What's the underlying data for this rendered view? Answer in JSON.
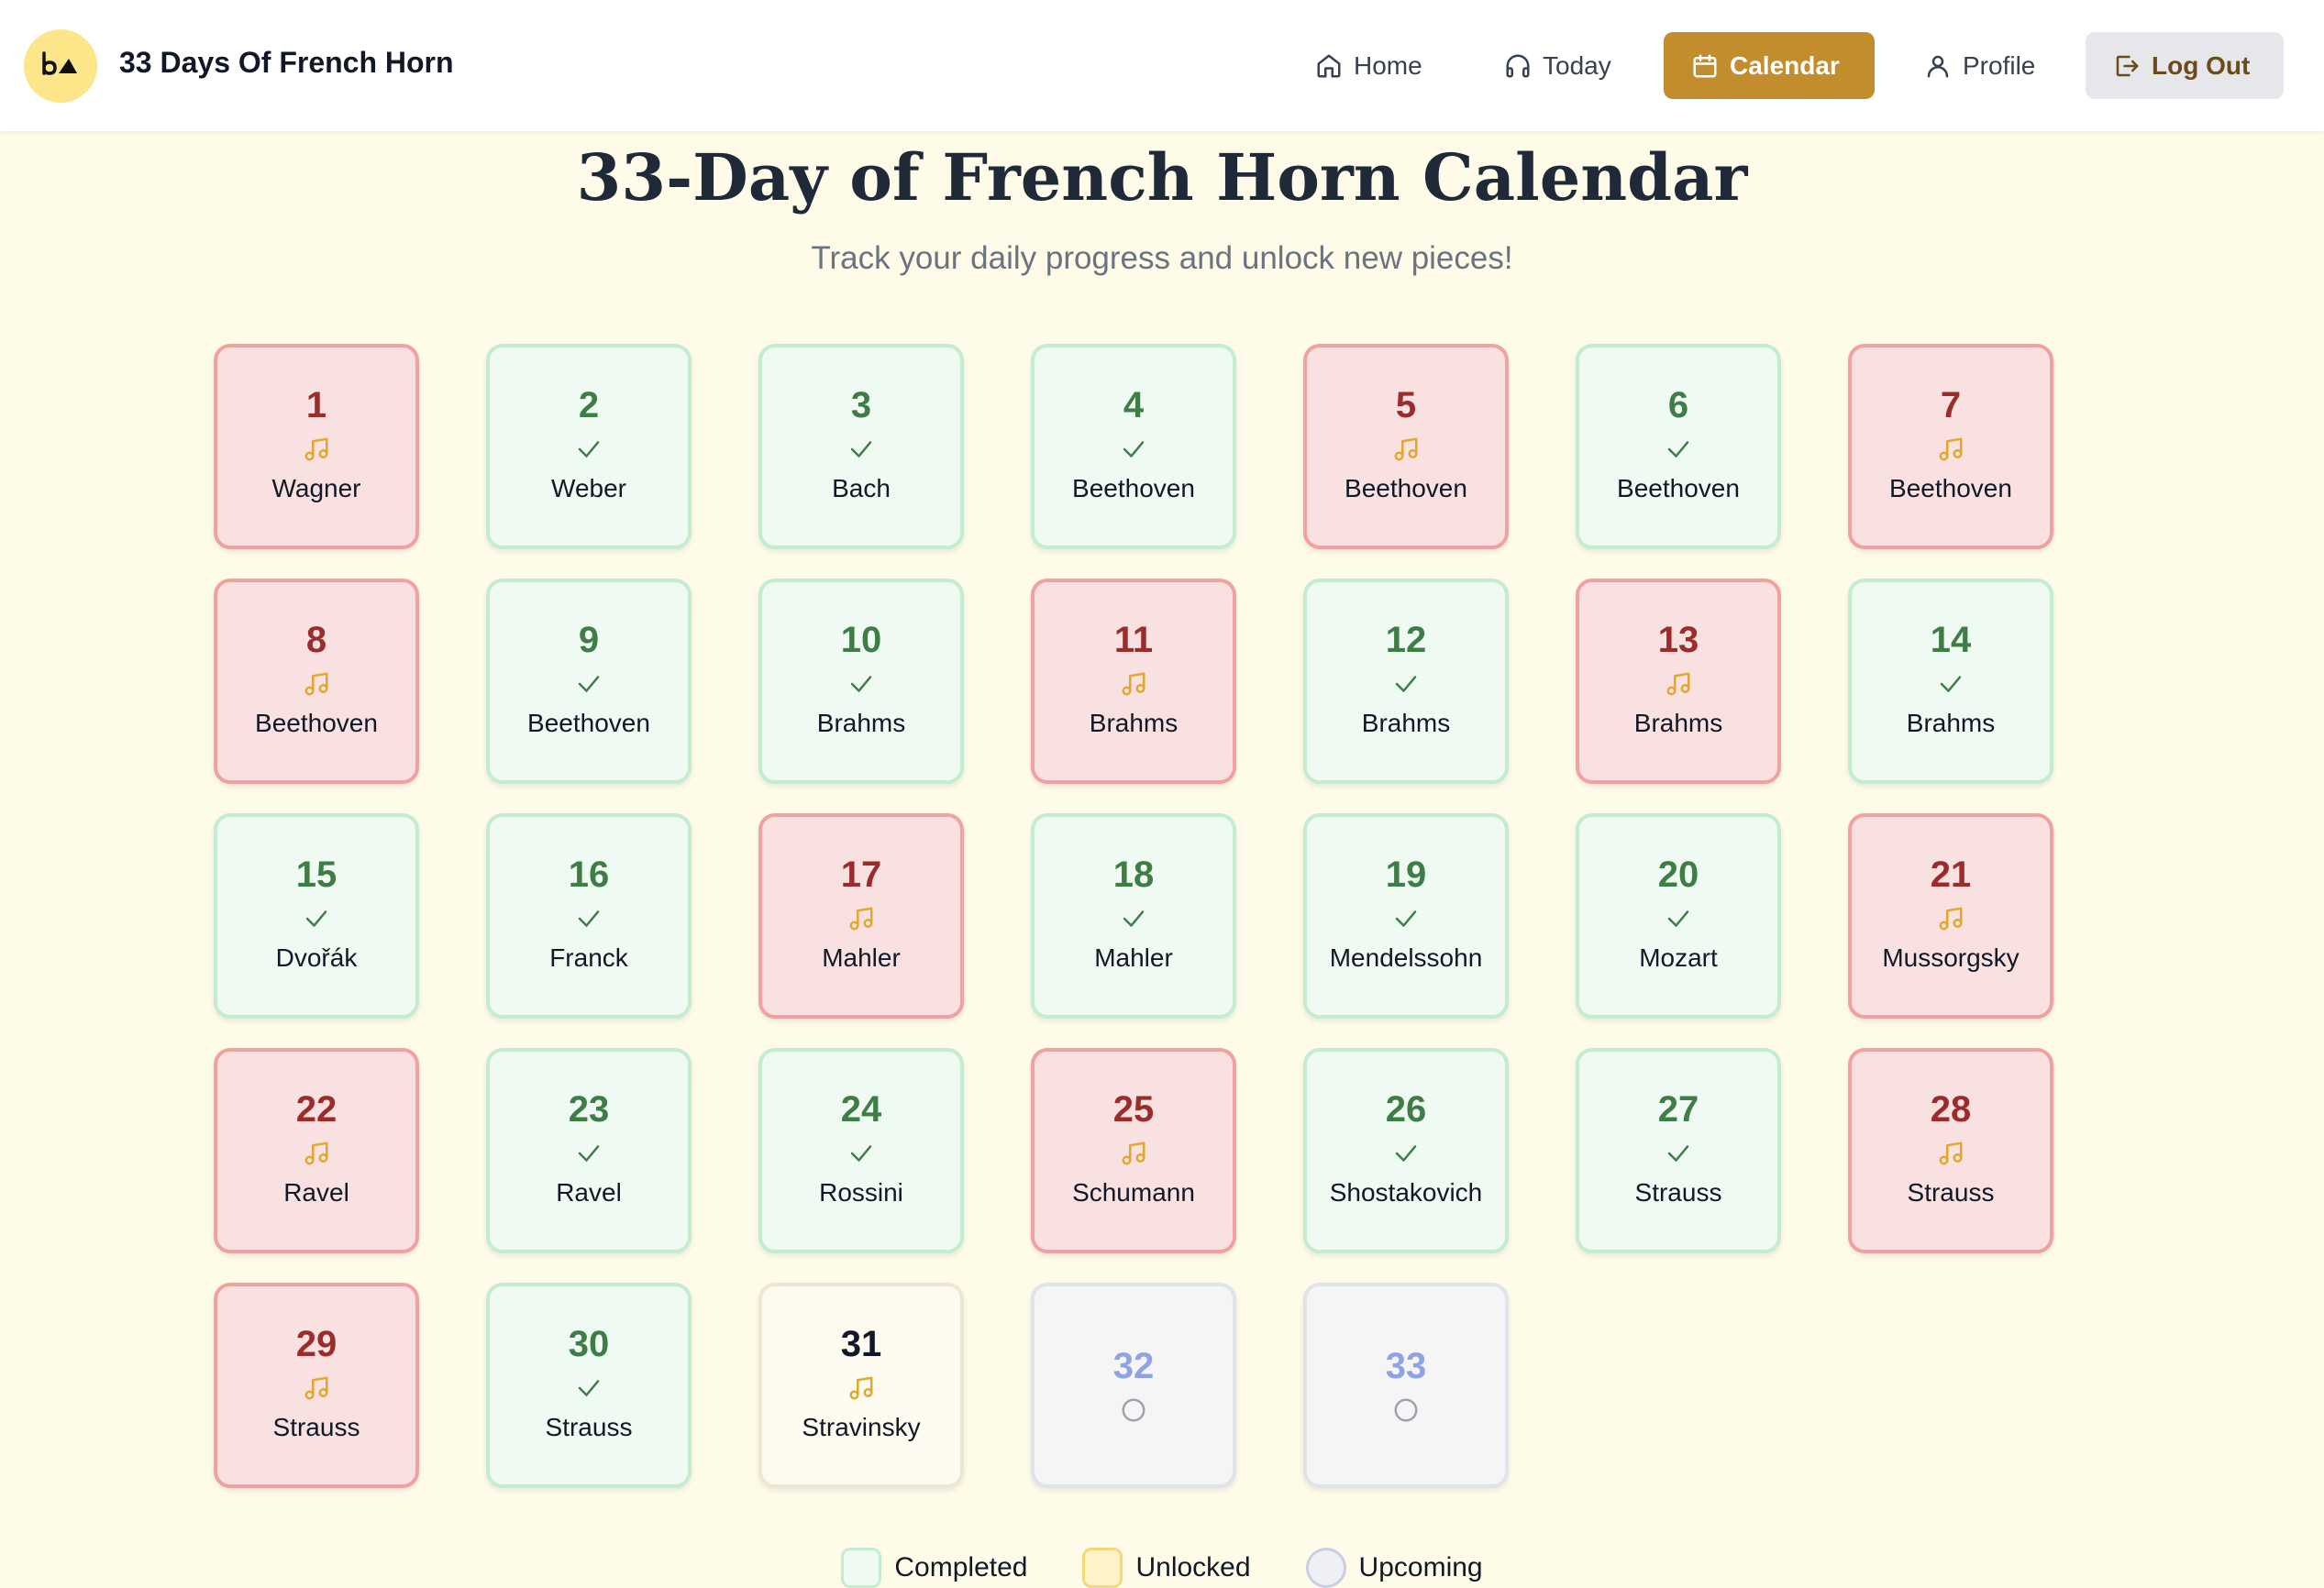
{
  "header": {
    "brand": "33 Days Of French Horn",
    "nav": {
      "home": "Home",
      "today": "Today",
      "calendar": "Calendar",
      "profile": "Profile",
      "logout": "Log Out"
    }
  },
  "page": {
    "title": "33-Day of French Horn Calendar",
    "subtitle": "Track your daily progress and unlock new pieces!"
  },
  "colors": {
    "accent": "#c38c2c",
    "completed": "#3f7d46",
    "unlocked": "#9b2c2c",
    "upcoming": "#8ea2e4"
  },
  "days": [
    {
      "day": "1",
      "composer": "Wagner",
      "status": "unlocked",
      "icon": "music-note-icon"
    },
    {
      "day": "2",
      "composer": "Weber",
      "status": "completed",
      "icon": "check-icon"
    },
    {
      "day": "3",
      "composer": "Bach",
      "status": "completed",
      "icon": "check-icon"
    },
    {
      "day": "4",
      "composer": "Beethoven",
      "status": "completed",
      "icon": "check-icon"
    },
    {
      "day": "5",
      "composer": "Beethoven",
      "status": "unlocked",
      "icon": "music-note-icon"
    },
    {
      "day": "6",
      "composer": "Beethoven",
      "status": "completed",
      "icon": "check-icon"
    },
    {
      "day": "7",
      "composer": "Beethoven",
      "status": "unlocked",
      "icon": "music-note-icon"
    },
    {
      "day": "8",
      "composer": "Beethoven",
      "status": "unlocked",
      "icon": "music-note-icon"
    },
    {
      "day": "9",
      "composer": "Beethoven",
      "status": "completed",
      "icon": "check-icon"
    },
    {
      "day": "10",
      "composer": "Brahms",
      "status": "completed",
      "icon": "check-icon"
    },
    {
      "day": "11",
      "composer": "Brahms",
      "status": "unlocked",
      "icon": "music-note-icon"
    },
    {
      "day": "12",
      "composer": "Brahms",
      "status": "completed",
      "icon": "check-icon"
    },
    {
      "day": "13",
      "composer": "Brahms",
      "status": "unlocked",
      "icon": "music-note-icon"
    },
    {
      "day": "14",
      "composer": "Brahms",
      "status": "completed",
      "icon": "check-icon"
    },
    {
      "day": "15",
      "composer": "Dvořák",
      "status": "completed",
      "icon": "check-icon"
    },
    {
      "day": "16",
      "composer": "Franck",
      "status": "completed",
      "icon": "check-icon"
    },
    {
      "day": "17",
      "composer": "Mahler",
      "status": "unlocked",
      "icon": "music-note-icon"
    },
    {
      "day": "18",
      "composer": "Mahler",
      "status": "completed",
      "icon": "check-icon"
    },
    {
      "day": "19",
      "composer": "Mendelssohn",
      "status": "completed",
      "icon": "check-icon"
    },
    {
      "day": "20",
      "composer": "Mozart",
      "status": "completed",
      "icon": "check-icon"
    },
    {
      "day": "21",
      "composer": "Mussorgsky",
      "status": "unlocked",
      "icon": "music-note-icon"
    },
    {
      "day": "22",
      "composer": "Ravel",
      "status": "unlocked",
      "icon": "music-note-icon"
    },
    {
      "day": "23",
      "composer": "Ravel",
      "status": "completed",
      "icon": "check-icon"
    },
    {
      "day": "24",
      "composer": "Rossini",
      "status": "completed",
      "icon": "check-icon"
    },
    {
      "day": "25",
      "composer": "Schumann",
      "status": "unlocked",
      "icon": "music-note-icon"
    },
    {
      "day": "26",
      "composer": "Shostakovich",
      "status": "completed",
      "icon": "check-icon"
    },
    {
      "day": "27",
      "composer": "Strauss",
      "status": "completed",
      "icon": "check-icon"
    },
    {
      "day": "28",
      "composer": "Strauss",
      "status": "unlocked",
      "icon": "music-note-icon"
    },
    {
      "day": "29",
      "composer": "Strauss",
      "status": "unlocked",
      "icon": "music-note-icon"
    },
    {
      "day": "30",
      "composer": "Strauss",
      "status": "completed",
      "icon": "check-icon"
    },
    {
      "day": "31",
      "composer": "Stravinsky",
      "status": "current",
      "icon": "music-note-icon"
    },
    {
      "day": "32",
      "composer": "",
      "status": "upcoming",
      "icon": "empty-circle-icon"
    },
    {
      "day": "33",
      "composer": "",
      "status": "upcoming",
      "icon": "empty-circle-icon"
    }
  ],
  "legend": [
    {
      "label": "Completed",
      "key": "completed"
    },
    {
      "label": "Unlocked",
      "key": "unlocked"
    },
    {
      "label": "Upcoming",
      "key": "upcoming"
    }
  ]
}
